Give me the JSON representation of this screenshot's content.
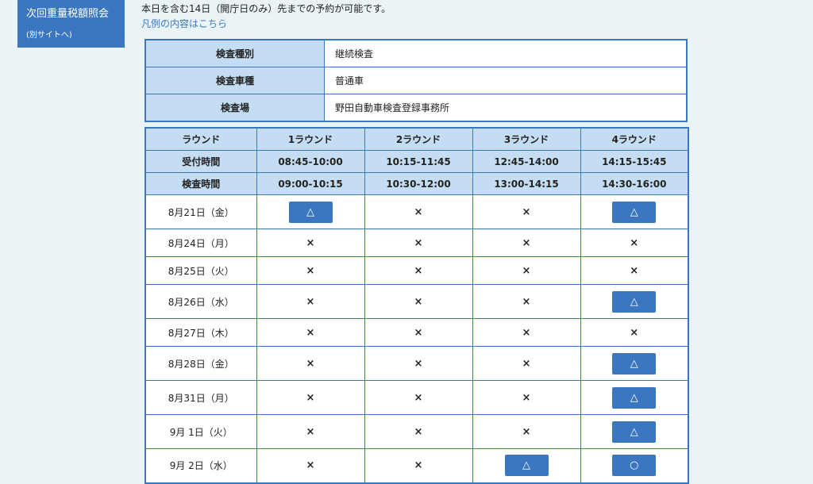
{
  "sidebar": {
    "title": "次回重量税額照会",
    "subtitle": "(別サイトへ)"
  },
  "notice": "本日を含む14日（開庁日のみ）先までの予約が可能です。",
  "legend_link": "凡例の内容はこちら",
  "info": [
    {
      "label": "検査種別",
      "value": "継続検査"
    },
    {
      "label": "検査車種",
      "value": "普通車"
    },
    {
      "label": "検査場",
      "value": "野田自動車検査登録事務所"
    }
  ],
  "schedule": {
    "header": {
      "round": {
        "label": "ラウンド",
        "cols": [
          "1ラウンド",
          "2ラウンド",
          "3ラウンド",
          "4ラウンド"
        ]
      },
      "reception": {
        "label": "受付時間",
        "cols": [
          "08:45-10:00",
          "10:15-11:45",
          "12:45-14:00",
          "14:15-15:45"
        ]
      },
      "inspection": {
        "label": "検査時間",
        "cols": [
          "09:00-10:15",
          "10:30-12:00",
          "13:00-14:15",
          "14:30-16:00"
        ]
      }
    },
    "rows": [
      {
        "date": "8月21日（金）",
        "slots": [
          "△",
          "×",
          "×",
          "△"
        ]
      },
      {
        "date": "8月24日（月）",
        "slots": [
          "×",
          "×",
          "×",
          "×"
        ]
      },
      {
        "date": "8月25日（火）",
        "slots": [
          "×",
          "×",
          "×",
          "×"
        ]
      },
      {
        "date": "8月26日（水）",
        "slots": [
          "×",
          "×",
          "×",
          "△"
        ]
      },
      {
        "date": "8月27日（木）",
        "slots": [
          "×",
          "×",
          "×",
          "×"
        ]
      },
      {
        "date": "8月28日（金）",
        "slots": [
          "×",
          "×",
          "×",
          "△"
        ]
      },
      {
        "date": "8月31日（月）",
        "slots": [
          "×",
          "×",
          "×",
          "△"
        ]
      },
      {
        "date": "9月 1日（火）",
        "slots": [
          "×",
          "×",
          "×",
          "△"
        ]
      },
      {
        "date": "9月 2日（水）",
        "slots": [
          "×",
          "×",
          "△",
          "○"
        ]
      }
    ]
  },
  "colors": {
    "accent": "#3a77c0",
    "header_bg": "#c4ddf2",
    "page_bg": "#eaf4f7"
  }
}
